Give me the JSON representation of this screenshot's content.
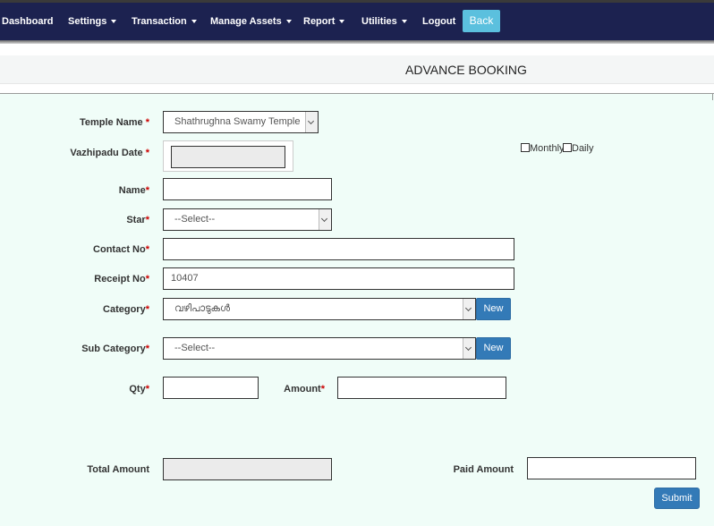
{
  "nav": {
    "items": [
      {
        "label": "Dashboard",
        "dropdown": false
      },
      {
        "label": "Settings",
        "dropdown": true
      },
      {
        "label": "Transaction",
        "dropdown": true
      },
      {
        "label": "Manage Assets",
        "dropdown": true
      },
      {
        "label": "Report",
        "dropdown": true
      },
      {
        "label": "Utilities",
        "dropdown": true
      },
      {
        "label": "Logout",
        "dropdown": false
      }
    ],
    "back_label": "Back",
    "colors": {
      "navbar": "#1c2250",
      "back_button": "#5bc0de"
    }
  },
  "page": {
    "title": "ADVANCE BOOKING"
  },
  "form": {
    "required_mark": "*",
    "temple": {
      "label": "Temple Name",
      "value": "Shathrughna Swamy Temple"
    },
    "vazhipadu_date": {
      "label": "Vazhipadu Date",
      "value": ""
    },
    "recurrence": {
      "monthly_label": "Monthly",
      "daily_label": "Daily",
      "monthly_checked": false,
      "daily_checked": false
    },
    "name": {
      "label": "Name",
      "value": ""
    },
    "star": {
      "label": "Star",
      "value": "--Select--"
    },
    "contact": {
      "label": "Contact No",
      "value": ""
    },
    "receipt": {
      "label": "Receipt No",
      "value": "10407"
    },
    "category": {
      "label": "Category",
      "value": "വഴിപാടുകൾ",
      "new_label": "New"
    },
    "sub_category": {
      "label": "Sub Category",
      "value": "--Select--",
      "new_label": "New"
    },
    "qty": {
      "label": "Qty",
      "value": ""
    },
    "amount": {
      "label": "Amount",
      "value": ""
    },
    "total_amount": {
      "label": "Total Amount",
      "value": ""
    },
    "paid_amount": {
      "label": "Paid Amount",
      "value": ""
    },
    "submit_label": "Submit",
    "colors": {
      "primary_button": "#337ab7",
      "required": "#cc0000",
      "background": "#f0fdf8"
    }
  }
}
